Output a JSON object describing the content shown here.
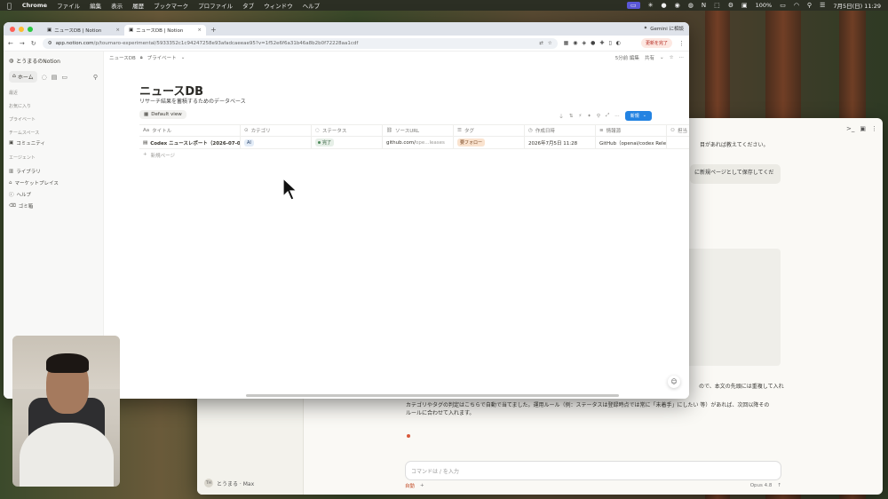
{
  "menubar": {
    "app": "Chrome",
    "items": [
      "ファイル",
      "編集",
      "表示",
      "履歴",
      "ブックマーク",
      "プロファイル",
      "タブ",
      "ウィンドウ",
      "ヘルプ"
    ],
    "battery": "100%",
    "datetime": "7月5日(日)  11:29"
  },
  "browser": {
    "tabs": [
      {
        "label": "ニュースDB | Notion",
        "active": false
      },
      {
        "label": "ニュースDB | Notion",
        "active": true
      }
    ],
    "gemini_label": "Gemini に相談",
    "url_host": "app.notion.com",
    "url_path": "/p/toumaro-experimental/5933352c1c94247258e93afadcaeeae95?v=1f52e6f6a31b46a8b2b0f72228aa1cdf",
    "update_label": "更新を完了"
  },
  "notion": {
    "workspace": "とうまるのNotion",
    "home_label": "ホーム",
    "sections": {
      "recent": "最近",
      "favorites": "お気に入り",
      "private": "プライベート",
      "teamspace": "チームスペース",
      "agent": "エージェント"
    },
    "teamspace_items": [
      "コミュニティ"
    ],
    "bottom_items": [
      "ライブラリ",
      "マーケットプレイス",
      "ヘルプ",
      "ゴミ箱"
    ],
    "breadcrumb": "ニュースDB",
    "breadcrumb_private": "プライベート",
    "edited": "5分前 編集",
    "share": "共有",
    "db_title": "ニュースDB",
    "db_description": "リサーチ結果を蓄積するためのデータベース",
    "view_label": "Default view",
    "new_button": "新規",
    "columns": [
      "タイトル",
      "カテゴリ",
      "ステータス",
      "ソースURL",
      "タグ",
      "作成日時",
      "情報源",
      "担当"
    ],
    "rows": [
      {
        "title": "Codex ニュースレポート（2026-07-0",
        "category": "AI",
        "status": "完了",
        "url_main": "github.com/",
        "url_rest": "ope...leases",
        "tag": "要フォロー",
        "created": "2026年7月5日 11:28",
        "source": "GitHub（openai/codex Releas",
        "owner": ""
      }
    ],
    "new_page": "新規ページ"
  },
  "back_window": {
    "line1": "目があれば教えてください。",
    "bubble": "に新規ページとして保存してくだ",
    "line2": "ので、本文の先頭には重複して入れ",
    "line3": "カテゴリやタグの判定はこちらで自動で当てました。運用ルール（例：ステータスは登録時点では常に「未着手」にしたい 等）があれば、次回以降その",
    "line4": "ルールに合わせて入れます。",
    "input_placeholder": "コマンドは / を入力",
    "mode": "自動",
    "model": "Opus 4.8",
    "user": "とうまる · Max",
    "user_initials": "TH"
  }
}
